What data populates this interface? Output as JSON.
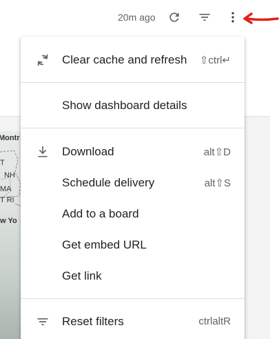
{
  "toolbar": {
    "timestamp": "20m ago",
    "icons": [
      "refresh-icon",
      "filter-icon",
      "more-vert-icon"
    ]
  },
  "map": {
    "labels": [
      "Montr",
      "T",
      "NH",
      "MA",
      "T RI",
      "ew Yo"
    ]
  },
  "menu": {
    "items": [
      {
        "label": "Clear cache and refresh",
        "shortcut": "⇧ctrl↵",
        "icon": "refresh-icon"
      },
      {
        "label": "Show dashboard details",
        "shortcut": "",
        "icon": ""
      },
      {
        "label": "Download",
        "shortcut": "alt⇧D",
        "icon": "download-icon"
      },
      {
        "label": "Schedule delivery",
        "shortcut": "alt⇧S",
        "icon": ""
      },
      {
        "label": "Add to a board",
        "shortcut": "",
        "icon": ""
      },
      {
        "label": "Get embed URL",
        "shortcut": "",
        "icon": ""
      },
      {
        "label": "Get link",
        "shortcut": "",
        "icon": ""
      },
      {
        "label": "Reset filters",
        "shortcut": "ctrlaltR",
        "icon": "filter-icon"
      }
    ]
  },
  "colors": {
    "text_primary": "#202124",
    "text_secondary": "#5f6368",
    "divider": "#dadce0",
    "annotation_arrow": "#e0201b"
  }
}
